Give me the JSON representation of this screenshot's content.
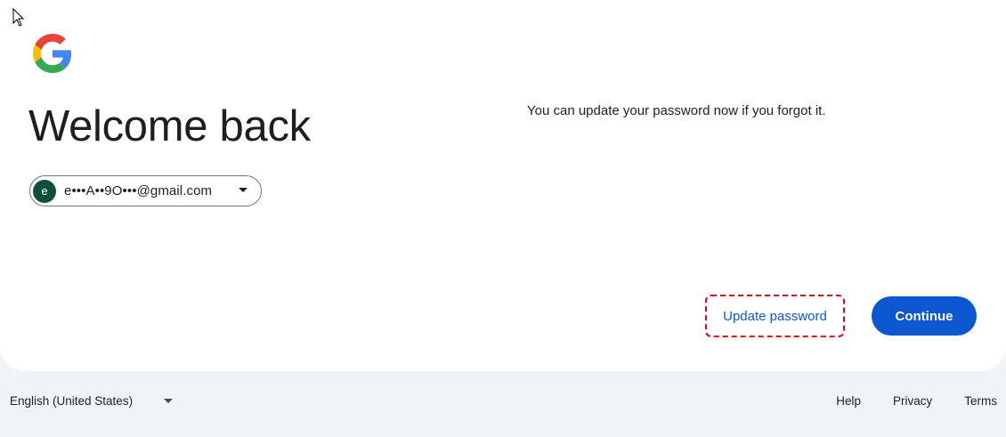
{
  "page": {
    "title": "Welcome back",
    "info_text": "You can update your password now if you forgot it."
  },
  "account": {
    "avatar_initial": "e",
    "email": "e•••A••9O•••@gmail.com",
    "avatar_color": "#0d4f3c",
    "dropdown_icon": "chevron-down-icon"
  },
  "actions": {
    "update_password_label": "Update password",
    "continue_label": "Continue",
    "highlight_color": "#e0001b"
  },
  "footer": {
    "language": "English (United States)",
    "links": [
      "Help",
      "Privacy",
      "Terms"
    ]
  },
  "colors": {
    "primary": "#0b57d0",
    "background": "#f0f4f9",
    "card": "#ffffff"
  },
  "icons": {
    "logo": "google-g-logo",
    "cursor": "mouse-cursor-icon"
  }
}
